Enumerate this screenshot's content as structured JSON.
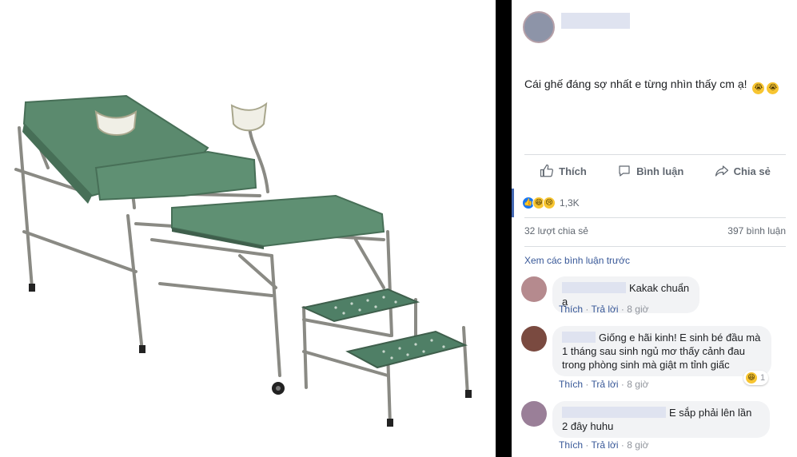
{
  "post": {
    "text": "Cái ghế đáng sợ nhất e từng nhìn thấy cm ạ!",
    "emojis": [
      "😭",
      "😭"
    ]
  },
  "actions": {
    "like_label": "Thích",
    "comment_label": "Bình luận",
    "share_label": "Chia sẻ"
  },
  "reactions": {
    "count": "1,3K",
    "icons": [
      "like-icon",
      "haha-icon",
      "sad-icon"
    ]
  },
  "stats": {
    "shares": "32 lượt chia sẻ",
    "comments": "397 bình luận"
  },
  "view_previous": "Xem các bình luận trước",
  "comments": [
    {
      "text": "Kakak chuẩn ạ",
      "like": "Thích",
      "reply": "Trả lời",
      "time": "8 giờ",
      "avatar_color": "#b58a8e"
    },
    {
      "text": "Giống e hãi kinh! E sinh bé đầu mà 1 tháng sau sinh ngủ mơ thấy cảnh đau trong phòng sinh mà giật m tỉnh giấc",
      "like": "Thích",
      "reply": "Trả lời",
      "time": "8 giờ",
      "reaction_count": "1",
      "avatar_color": "#7a4a40"
    },
    {
      "text": "E sắp phải lên lần 2 đây huhu",
      "like": "Thích",
      "reply": "Trả lời",
      "time": "8 giờ",
      "avatar_color": "#9a7f98"
    }
  ],
  "separator": "·",
  "colors": {
    "link": "#385898",
    "meta": "#90949c",
    "accent": "#4267b2",
    "chair_cushion": "#5b8a6e"
  }
}
